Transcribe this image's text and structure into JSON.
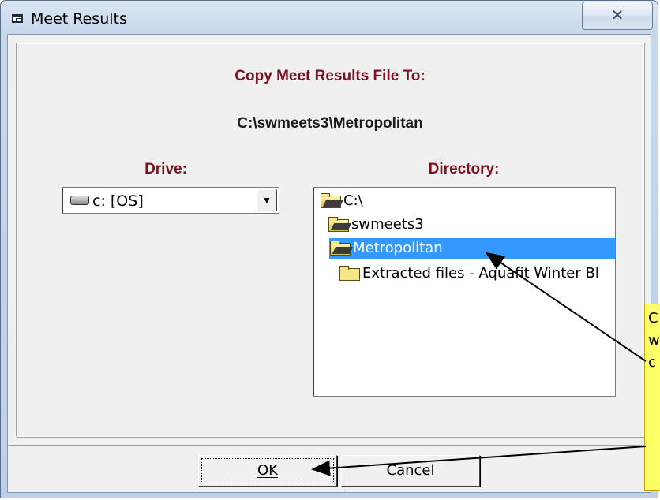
{
  "window": {
    "title": "Meet Results",
    "close_glyph": "✕"
  },
  "header": {
    "line1": "Copy Meet Results File To:",
    "line2": "C:\\swmeets3\\Metropolitan"
  },
  "drive": {
    "label": "Drive:",
    "selected": "c: [OS]",
    "icon": "drive-icon"
  },
  "directory": {
    "label": "Directory:",
    "items": [
      {
        "name": "C:\\",
        "icon": "open-folder-icon"
      },
      {
        "name": "swmeets3",
        "icon": "open-folder-icon"
      },
      {
        "name": "Metropolitan",
        "icon": "open-folder-icon",
        "selected": true
      },
      {
        "name": "Extracted files - Aquafit Winter BI",
        "icon": "folder-icon"
      }
    ]
  },
  "buttons": {
    "ok": "OK",
    "cancel": "Cancel"
  },
  "callout": {
    "lines": [
      "C",
      "w",
      "c"
    ],
    "color": "#ffff66"
  }
}
